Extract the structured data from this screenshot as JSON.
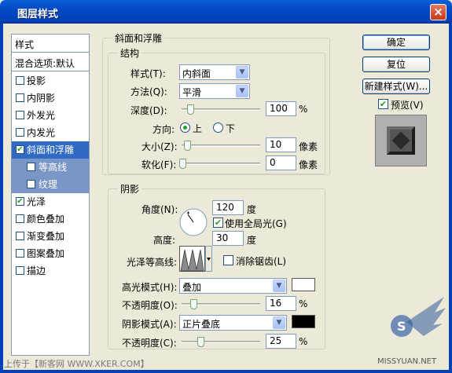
{
  "window": {
    "title": "图层样式",
    "close_glyph": "×"
  },
  "left_panel": {
    "header": "样式",
    "blend_options": "混合选项:默认",
    "items": [
      {
        "label": "投影",
        "checked": false
      },
      {
        "label": "内阴影",
        "checked": false
      },
      {
        "label": "外发光",
        "checked": false
      },
      {
        "label": "内发光",
        "checked": false
      },
      {
        "label": "斜面和浮雕",
        "checked": true,
        "selected": true
      },
      {
        "label": "等高线",
        "checked": false,
        "sub": true
      },
      {
        "label": "纹理",
        "checked": false,
        "sub": true
      },
      {
        "label": "光泽",
        "checked": true
      },
      {
        "label": "颜色叠加",
        "checked": false
      },
      {
        "label": "渐变叠加",
        "checked": false
      },
      {
        "label": "图案叠加",
        "checked": false
      },
      {
        "label": "描边",
        "checked": false
      }
    ],
    "check_glyph": "✔"
  },
  "bevel": {
    "title": "斜面和浮雕",
    "structure_title": "结构",
    "style_label": "样式(T):",
    "style_value": "内斜面",
    "technique_label": "方法(Q):",
    "technique_value": "平滑",
    "depth_label": "深度(D):",
    "depth_value": "100",
    "depth_unit": "%",
    "direction_label": "方向:",
    "direction_up": "上",
    "direction_down": "下",
    "size_label": "大小(Z):",
    "size_value": "10",
    "size_unit": "像素",
    "soften_label": "软化(F):",
    "soften_value": "0",
    "soften_unit": "像素"
  },
  "shading": {
    "title": "阴影",
    "angle_label": "角度(N):",
    "angle_value": "120",
    "angle_unit": "度",
    "global_light_label": "使用全局光(G)",
    "altitude_label": "高度:",
    "altitude_value": "30",
    "altitude_unit": "度",
    "gloss_contour_label": "光泽等高线:",
    "anti_aliased_label": "消除锯齿(L)",
    "highlight_mode_label": "高光模式(H):",
    "highlight_mode_value": "叠加",
    "highlight_color": "#ffffff",
    "highlight_opacity_label": "不透明度(O):",
    "highlight_opacity_value": "16",
    "shadow_mode_label": "阴影模式(A):",
    "shadow_mode_value": "正片叠底",
    "shadow_color": "#000000",
    "shadow_opacity_label": "不透明度(C):",
    "shadow_opacity_value": "25",
    "percent": "%"
  },
  "buttons": {
    "ok": "确定",
    "reset": "复位",
    "new_style": "新建样式(W)...",
    "preview_label": "预览(V)"
  },
  "watermark": {
    "left": "上传于【新客网 WWW.XKER.COM】",
    "right": "MISSYUAN.NET"
  }
}
